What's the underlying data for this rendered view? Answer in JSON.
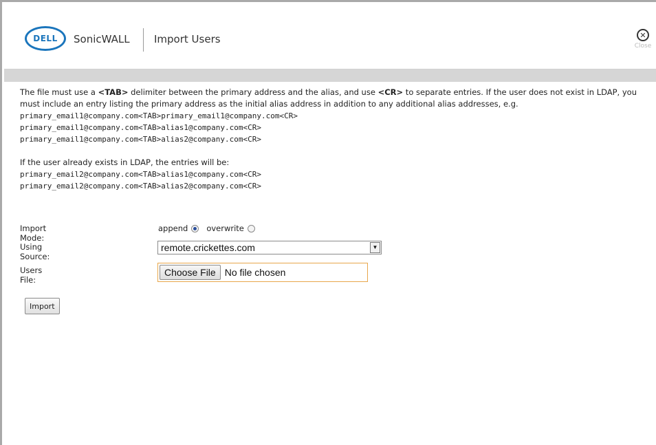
{
  "header": {
    "logo_text": "DELL",
    "brand": "SonicWALL",
    "title": "Import Users",
    "close_label": "Close",
    "close_glyph": "✕"
  },
  "instructions": {
    "p1_part1": "The file must use a ",
    "tab_token": "<TAB>",
    "p1_part2": " delimiter between the primary address and the alias, and use ",
    "cr_token": "<CR>",
    "p1_part3": " to separate entries. If the user does not exist in LDAP, you must include an entry listing the primary address as the initial alias address in addition to any additional alias addresses, e.g.",
    "example_lines": [
      "primary_email1@company.com<TAB>primary_email1@company.com<CR>",
      "primary_email1@company.com<TAB>alias1@company.com<CR>",
      "primary_email1@company.com<TAB>alias2@company.com<CR>"
    ],
    "p2": "If the user already exists in LDAP, the entries will be:",
    "existing_lines": [
      "primary_email2@company.com<TAB>alias1@company.com<CR>",
      "primary_email2@company.com<TAB>alias2@company.com<CR>"
    ]
  },
  "form": {
    "import_mode_label": "Import Mode:",
    "append_label": "append",
    "overwrite_label": "overwrite",
    "selected_mode": "append",
    "source_label": "Using Source:",
    "source_value": "remote.crickettes.com",
    "users_file_label": "Users File:",
    "choose_file_label": "Choose File",
    "no_file_text": "No file chosen",
    "import_button": "Import"
  },
  "colors": {
    "logo_blue": "#1a75bc",
    "bar_gray": "#d6d6d6",
    "focus_border": "#e8a64a"
  }
}
